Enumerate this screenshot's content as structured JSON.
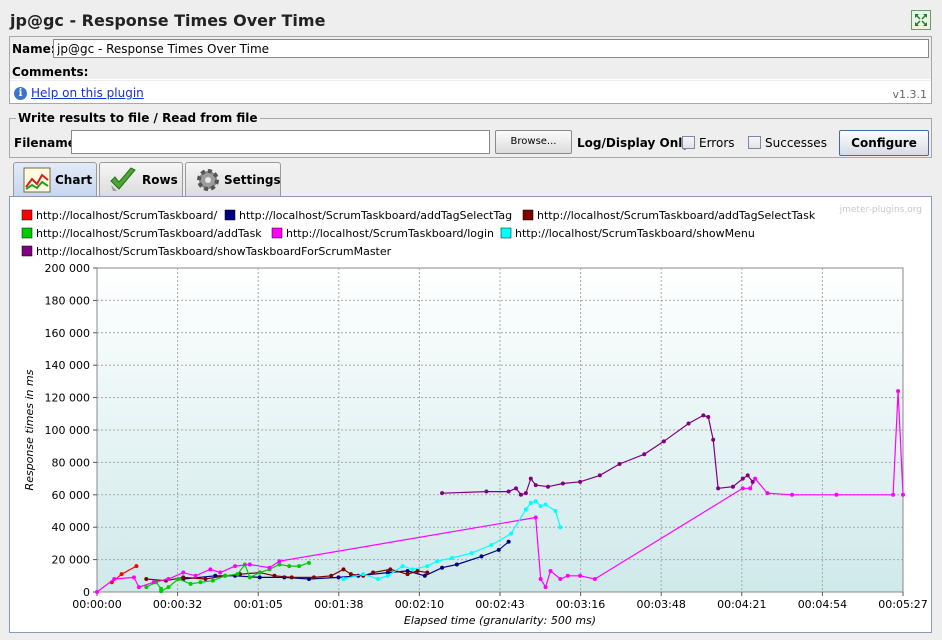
{
  "window": {
    "title": "jp@gc - Response Times Over Time"
  },
  "props": {
    "name_label": "Name:",
    "name_value": "jp@gc - Response Times Over Time",
    "comments_label": "Comments:",
    "help_link": "Help on this plugin",
    "version": "v1.3.1"
  },
  "file_panel": {
    "legend": "Write results to file / Read from file",
    "filename_label": "Filename",
    "filename_value": "",
    "browse_label": "Browse...",
    "log_display_label": "Log/Display Only:",
    "errors_label": "Errors",
    "errors_checked": false,
    "successes_label": "Successes",
    "successes_checked": false,
    "configure_label": "Configure"
  },
  "tabs": [
    {
      "label": "Chart",
      "icon": "chart-icon",
      "selected": true
    },
    {
      "label": "Rows",
      "icon": "checkmark-icon",
      "selected": false
    },
    {
      "label": "Settings",
      "icon": "gear-icon",
      "selected": false
    }
  ],
  "chart_data": {
    "type": "line",
    "watermark": "jmeter-plugins.org",
    "title": "",
    "xlabel": "Elapsed time (granularity: 500 ms)",
    "ylabel": "Response times in ms",
    "xlim": [
      0,
      327
    ],
    "ylim": [
      0,
      200000
    ],
    "x_tick_labels": [
      "00:00:00",
      "00:00:32",
      "00:01:05",
      "00:01:38",
      "00:02:10",
      "00:02:43",
      "00:03:16",
      "00:03:48",
      "00:04:21",
      "00:04:54",
      "00:05:27"
    ],
    "y_tick_labels": [
      "0",
      "20 000",
      "40 000",
      "60 000",
      "80 000",
      "100 000",
      "120 000",
      "140 000",
      "160 000",
      "180 000",
      "200 000"
    ],
    "grid": true,
    "legend_position": "top",
    "series": [
      {
        "name": "http://localhost/ScrumTaskboard/",
        "color": "#ff0000",
        "points": [
          [
            6,
            6000
          ],
          [
            10,
            11000
          ],
          [
            16,
            16000
          ]
        ]
      },
      {
        "name": "http://localhost/ScrumTaskboard/addTagSelectTag",
        "color": "#000080",
        "points": [
          [
            35,
            8000
          ],
          [
            48,
            10000
          ],
          [
            56,
            10000
          ],
          [
            66,
            9000
          ],
          [
            76,
            9000
          ],
          [
            86,
            8000
          ],
          [
            98,
            9000
          ],
          [
            106,
            10000
          ],
          [
            118,
            12000
          ],
          [
            126,
            13000
          ],
          [
            133,
            10000
          ],
          [
            140,
            15000
          ],
          [
            146,
            17000
          ],
          [
            156,
            22000
          ],
          [
            163,
            26000
          ],
          [
            167,
            31000
          ]
        ]
      },
      {
        "name": "http://localhost/ScrumTaskboard/addTagSelectTask",
        "color": "#800000",
        "points": [
          [
            20,
            8000
          ],
          [
            28,
            7000
          ],
          [
            35,
            9000
          ],
          [
            44,
            8000
          ],
          [
            52,
            10000
          ],
          [
            58,
            11000
          ],
          [
            66,
            12000
          ],
          [
            72,
            10000
          ],
          [
            79,
            9000
          ],
          [
            88,
            9000
          ],
          [
            95,
            10000
          ],
          [
            100,
            14000
          ],
          [
            103,
            11000
          ],
          [
            108,
            10000
          ],
          [
            112,
            12000
          ],
          [
            119,
            14000
          ],
          [
            126,
            11000
          ],
          [
            130,
            13000
          ],
          [
            134,
            12000
          ]
        ]
      },
      {
        "name": "http://localhost/ScrumTaskboard/addTask",
        "color": "#00cc00",
        "points": [
          [
            20,
            3000
          ],
          [
            24,
            6000
          ],
          [
            26,
            2000
          ],
          [
            26,
            500
          ],
          [
            29,
            3000
          ],
          [
            33,
            8000
          ],
          [
            38,
            5000
          ],
          [
            42,
            6000
          ],
          [
            47,
            7000
          ],
          [
            52,
            10000
          ],
          [
            57,
            11000
          ],
          [
            60,
            17000
          ],
          [
            62,
            9000
          ],
          [
            66,
            12000
          ],
          [
            70,
            14000
          ],
          [
            74,
            17000
          ],
          [
            78,
            16000
          ],
          [
            82,
            16000
          ],
          [
            86,
            18000
          ]
        ]
      },
      {
        "name": "http://localhost/ScrumTaskboard/login",
        "color": "#ff00ff",
        "points": [
          [
            0,
            0
          ],
          [
            7,
            8000
          ],
          [
            15,
            9000
          ],
          [
            17,
            3000
          ],
          [
            23,
            6000
          ],
          [
            29,
            8000
          ],
          [
            35,
            12000
          ],
          [
            40,
            10000
          ],
          [
            46,
            14000
          ],
          [
            50,
            12000
          ],
          [
            56,
            16000
          ],
          [
            62,
            17000
          ],
          [
            70,
            15000
          ],
          [
            74,
            19000
          ],
          [
            178,
            46000
          ],
          [
            180,
            8000
          ],
          [
            182,
            3000
          ],
          [
            184,
            13000
          ],
          [
            188,
            8000
          ],
          [
            191,
            10000
          ],
          [
            196,
            10000
          ],
          [
            202,
            8000
          ],
          [
            262,
            64000
          ],
          [
            265,
            64000
          ],
          [
            267,
            70000
          ],
          [
            272,
            61000
          ],
          [
            282,
            60000
          ],
          [
            300,
            60000
          ],
          [
            323,
            60000
          ],
          [
            325,
            124000
          ],
          [
            327,
            60000
          ]
        ]
      },
      {
        "name": "http://localhost/ScrumTaskboard/showMenu",
        "color": "#00ffff",
        "points": [
          [
            100,
            8000
          ],
          [
            108,
            11000
          ],
          [
            114,
            8000
          ],
          [
            118,
            10000
          ],
          [
            124,
            16000
          ],
          [
            128,
            14000
          ],
          [
            134,
            16000
          ],
          [
            138,
            19000
          ],
          [
            144,
            21000
          ],
          [
            152,
            24000
          ],
          [
            160,
            29000
          ],
          [
            168,
            36000
          ],
          [
            174,
            51000
          ],
          [
            176,
            55000
          ],
          [
            178,
            56000
          ],
          [
            180,
            53000
          ],
          [
            182,
            54000
          ],
          [
            186,
            50000
          ],
          [
            188,
            40000
          ]
        ]
      },
      {
        "name": "http://localhost/ScrumTaskboard/showTaskboardForScrumMaster",
        "color": "#800080",
        "points": [
          [
            140,
            61000
          ],
          [
            158,
            62000
          ],
          [
            167,
            62000
          ],
          [
            170,
            64000
          ],
          [
            172,
            60000
          ],
          [
            174,
            61000
          ],
          [
            176,
            70000
          ],
          [
            178,
            66000
          ],
          [
            183,
            65000
          ],
          [
            189,
            67000
          ],
          [
            196,
            68000
          ],
          [
            204,
            72000
          ],
          [
            212,
            79000
          ],
          [
            222,
            85000
          ],
          [
            230,
            93000
          ],
          [
            240,
            104000
          ],
          [
            246,
            109000
          ],
          [
            248,
            108000
          ],
          [
            250,
            94000
          ],
          [
            252,
            64000
          ],
          [
            258,
            65000
          ],
          [
            262,
            70000
          ],
          [
            264,
            72000
          ],
          [
            266,
            68000
          ]
        ]
      }
    ]
  }
}
